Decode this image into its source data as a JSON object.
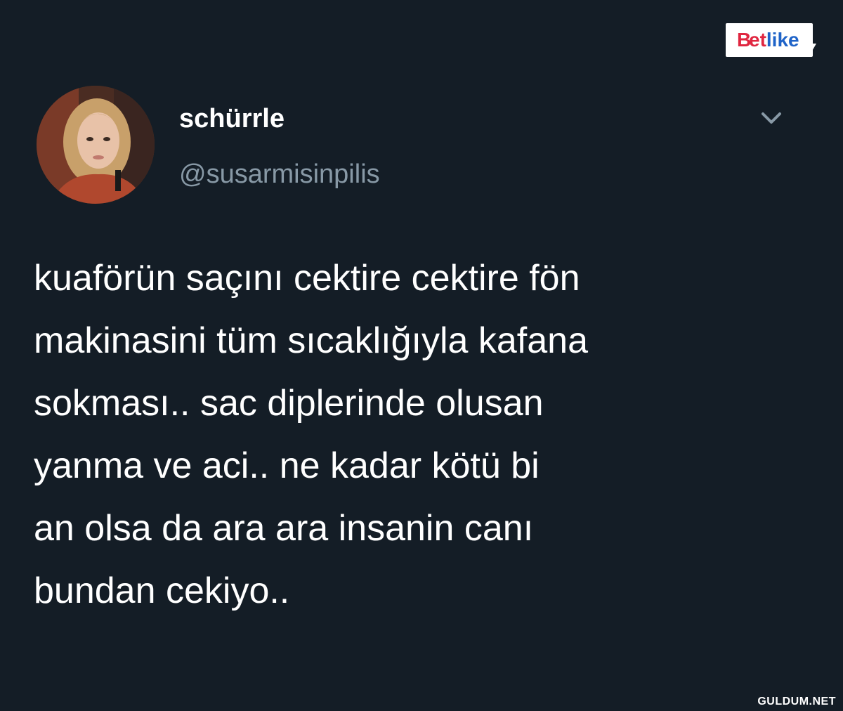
{
  "tweet": {
    "display_name": "schürrle",
    "handle": "@susarmisinpilis",
    "menu_icon": "chevron-down-icon",
    "avatar_icon": "avatar-photo",
    "lines": [
      "kuaförün saçını cektire cektire fön",
      "makinasini tüm sıcaklığıyla kafana",
      "sokması.. sac diplerinde olusan",
      "yanma ve aci.. ne kadar kötü bi",
      "an olsa da ara ara insanin canı",
      "bundan cekiyo.."
    ]
  },
  "branding": {
    "logo_text": "Betlike",
    "watermark": "GULDUM.NET"
  },
  "colors": {
    "background": "#141d26",
    "primary_text": "#ffffff",
    "secondary_text": "#8899a6",
    "logo_red": "#e02640",
    "logo_blue": "#1e63c8"
  }
}
